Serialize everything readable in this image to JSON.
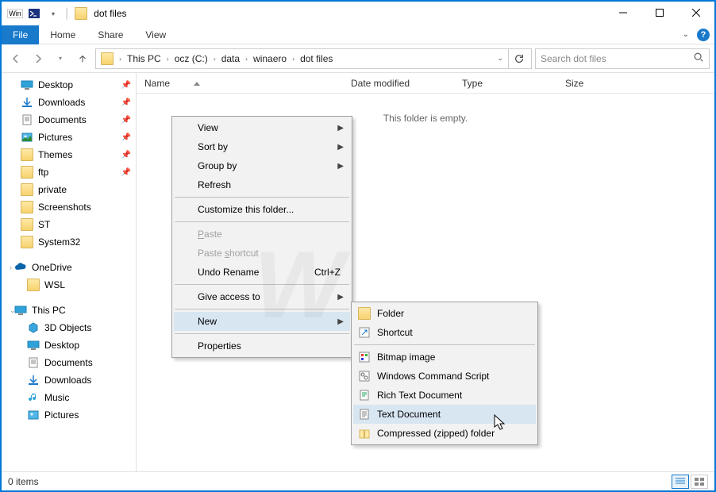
{
  "title": "dot files",
  "ribbon": {
    "file": "File",
    "home": "Home",
    "share": "Share",
    "view": "View"
  },
  "breadcrumbs": [
    "This PC",
    "ocz (C:)",
    "data",
    "winaero",
    "dot files"
  ],
  "search_placeholder": "Search dot files",
  "nav": {
    "quick": [
      "Desktop",
      "Downloads",
      "Documents",
      "Pictures",
      "Themes",
      "ftp",
      "private",
      "Screenshots",
      "ST",
      "System32"
    ],
    "onedrive": "OneDrive",
    "wsl": "WSL",
    "thispc": "This PC",
    "thispc_items": [
      "3D Objects",
      "Desktop",
      "Documents",
      "Downloads",
      "Music",
      "Pictures"
    ]
  },
  "columns": {
    "name": "Name",
    "date": "Date modified",
    "type": "Type",
    "size": "Size"
  },
  "empty_message": "This folder is empty.",
  "status": "0 items",
  "context_menu": {
    "view": "View",
    "sort_by": "Sort by",
    "group_by": "Group by",
    "refresh": "Refresh",
    "customize": "Customize this folder...",
    "paste": "Paste",
    "paste_shortcut": "Paste shortcut",
    "undo_rename": "Undo Rename",
    "undo_sc": "Ctrl+Z",
    "give_access": "Give access to",
    "new": "New",
    "properties": "Properties"
  },
  "new_submenu": {
    "folder": "Folder",
    "shortcut": "Shortcut",
    "bitmap": "Bitmap image",
    "cmd": "Windows Command Script",
    "rtf": "Rich Text Document",
    "txt": "Text Document",
    "zip": "Compressed (zipped) folder"
  }
}
